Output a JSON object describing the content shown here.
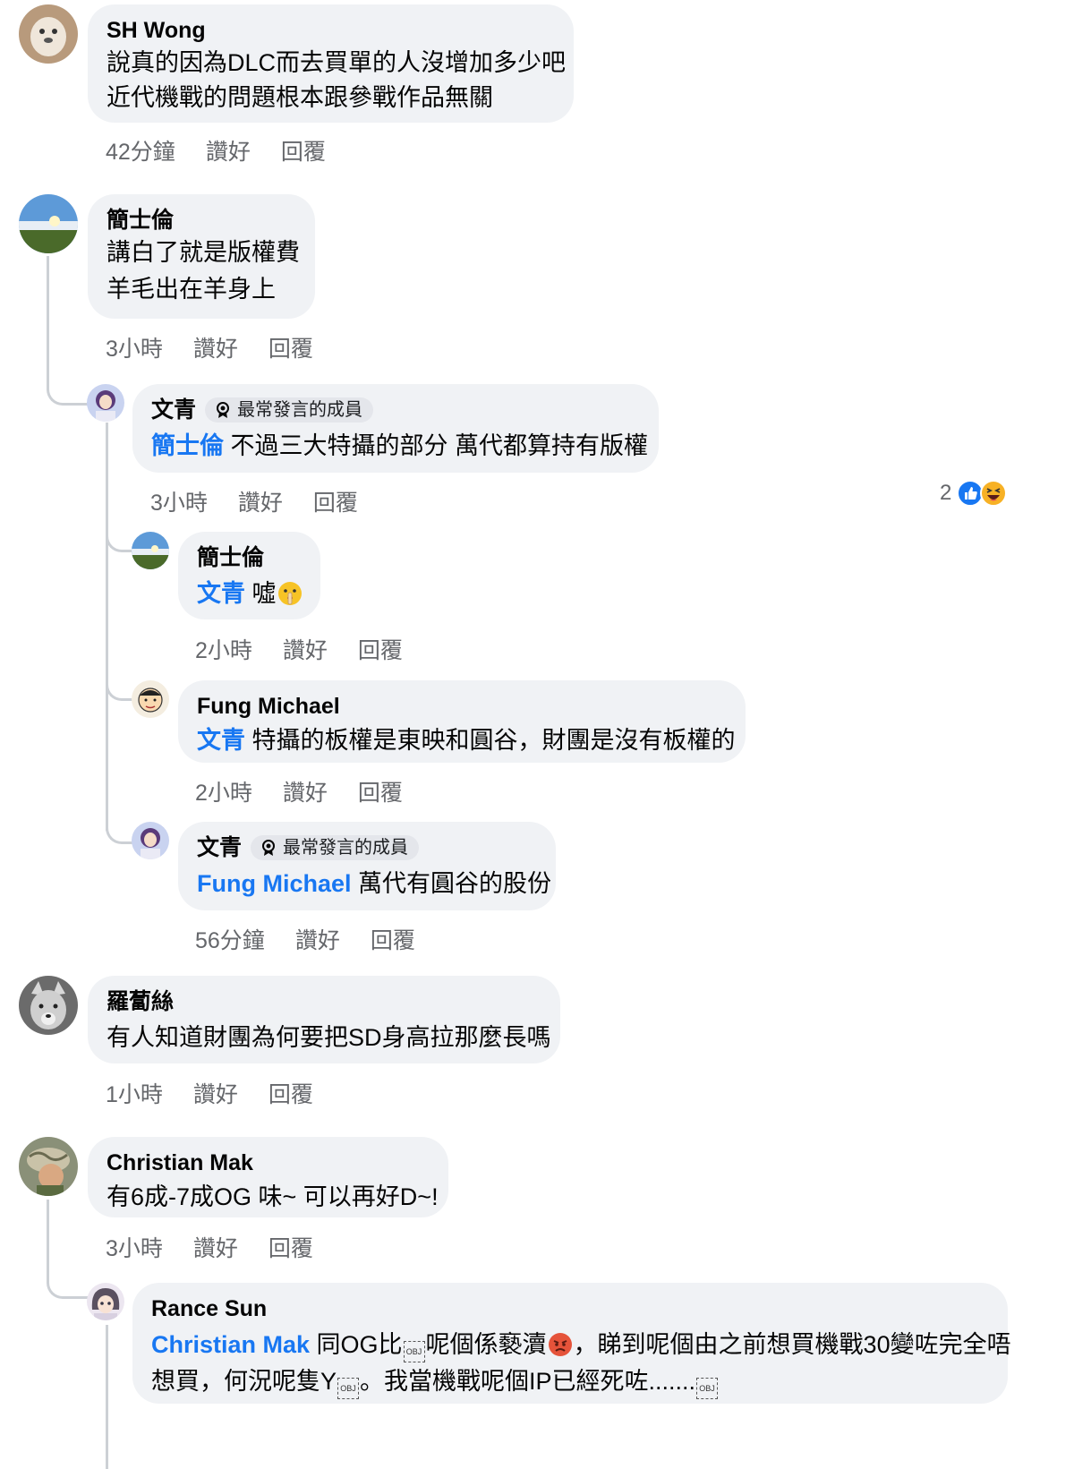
{
  "actions": {
    "like": "讚好",
    "reply": "回覆"
  },
  "badge_label": "最常發言的成員",
  "comments": [
    {
      "author": "SH Wong",
      "lines": [
        "說真的因為DLC而去買單的人沒增加多少吧",
        "近代機戰的問題根本跟參戰作品無關"
      ],
      "time": "42分鐘"
    },
    {
      "author": "簡士倫",
      "lines": [
        "講白了就是版權費",
        "羊毛出在羊身上"
      ],
      "time": "3小時",
      "replies": [
        {
          "author": "文青",
          "mention": "簡士倫",
          "text": " 不過三大特攝的部分 萬代都算持有版權",
          "time": "3小時",
          "reaction_count": "2"
        },
        {
          "author": "簡士倫",
          "mention": "文青",
          "text": " 噓",
          "time": "2小時"
        },
        {
          "author": "Fung Michael",
          "mention": "文青",
          "text": " 特攝的板權是東映和圓谷，財團是沒有板權的",
          "time": "2小時"
        },
        {
          "author": "文青",
          "mention": "Fung Michael",
          "text": " 萬代有圓谷的股份",
          "time": "56分鐘"
        }
      ]
    },
    {
      "author": "羅蔔絲",
      "lines": [
        "有人知道財團為何要把SD身高拉那麼長嗎"
      ],
      "time": "1小時"
    },
    {
      "author": "Christian Mak",
      "lines": [
        "有6成-7成OG 味~ 可以再好D~!"
      ],
      "time": "3小時",
      "replies": [
        {
          "author": "Rance Sun",
          "mention": "Christian Mak",
          "text_a": " 同OG比",
          "text_b": "呢個係褻瀆",
          "text_c": "，睇到呢個由之前想買機戰30變咗完全唔",
          "line2_a": "想買，何況呢隻Y",
          "line2_b": "。我當機戰呢個IP已經死咗.......",
          "obj_label": "OBJ"
        }
      ]
    }
  ],
  "colors": {
    "bubble": "#f0f2f5",
    "mention": "#1877f2",
    "meta": "#65676b"
  }
}
